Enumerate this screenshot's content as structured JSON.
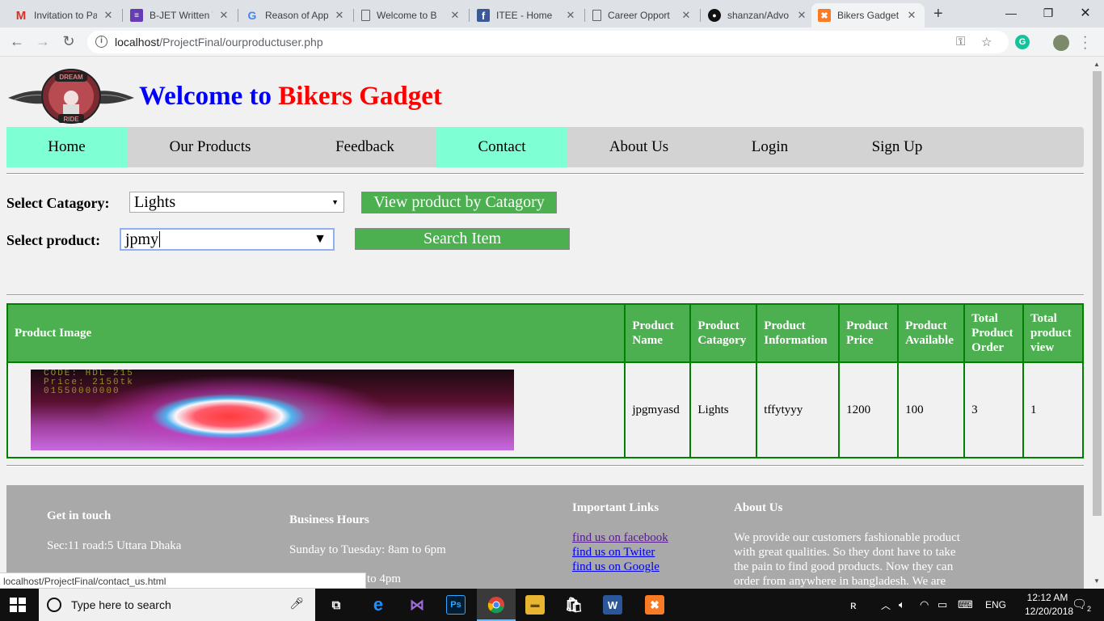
{
  "browser": {
    "tabs": [
      {
        "title": "Invitation to Pa",
        "icon": "gmail-icon",
        "fav": "M"
      },
      {
        "title": "B-JET Written T",
        "icon": "forms-icon",
        "fav": "≡"
      },
      {
        "title": "Reason of Appl",
        "icon": "google-icon",
        "fav": "G"
      },
      {
        "title": "Welcome to B",
        "icon": "page-icon",
        "fav": "🗋"
      },
      {
        "title": "ITEE - Home",
        "icon": "facebook-icon",
        "fav": "f"
      },
      {
        "title": "Career Opport",
        "icon": "page-icon",
        "fav": "🗋"
      },
      {
        "title": "shanzan/Advo",
        "icon": "github-icon",
        "fav": "●"
      },
      {
        "title": "Bikers Gadget",
        "icon": "xampp-icon",
        "fav": "✖"
      }
    ],
    "url_host": "localhost",
    "url_path": "/ProjectFinal/ourproductuser.php",
    "status_url": "localhost/ProjectFinal/contact_us.html"
  },
  "site": {
    "welcome": "Welcome to",
    "brand": "Bikers Gadget",
    "logo_text": "DREAM RIDE",
    "nav": [
      "Home",
      "Our Products",
      "Feedback",
      "Contact",
      "About Us",
      "Login",
      "Sign Up"
    ]
  },
  "form": {
    "category_label": "Select Catagory:",
    "category_value": "Lights",
    "view_button": "View product by Catagory",
    "product_label": "Select product:",
    "product_value": "jpmy",
    "search_button": "Search Item"
  },
  "table": {
    "headers": [
      "Product Image",
      "Product Name",
      "Product Catagory",
      "Product Information",
      "Product Price",
      "Product Available",
      "Total Product Order",
      "Total product view"
    ],
    "rows": [
      {
        "image_code": "CODE: HDL 215",
        "image_price": "Price: 2150tk",
        "image_phone": "01550000000",
        "name": "jpgmyasd",
        "category": "Lights",
        "info": "tffytyyy",
        "price": "1200",
        "available": "100",
        "orders": "3",
        "views": "1"
      }
    ]
  },
  "footer": {
    "touch_title": "Get in touch",
    "touch_address": "Sec:11 road:5 Uttara Dhaka",
    "hours_title": "Business Hours",
    "hours_line1": "Sunday to Tuesday: 8am to 6pm",
    "hours_line2": "to 4pm",
    "links_title": "Important Links",
    "links": [
      "find us on facebook",
      "find us on Twiter",
      "find us on Google"
    ],
    "about_title": "About Us",
    "about_lines": [
      "We provide our customers fashionable product",
      "with great qualities. So they dont have to take",
      "the pain to find good products. Now they can",
      "order from anywhere in bangladesh. We are"
    ]
  },
  "taskbar": {
    "search_placeholder": "Type here to search",
    "language": "ENG",
    "time": "12:12 AM",
    "date": "12/20/2018",
    "notifications": "2"
  },
  "colors": {
    "nav_highlight": "#7fffd4",
    "button_green": "#4caf50",
    "table_border": "#008000",
    "footer_bg": "#a9a9a9",
    "title_blue": "#0000ff",
    "title_red": "#ff0000"
  }
}
